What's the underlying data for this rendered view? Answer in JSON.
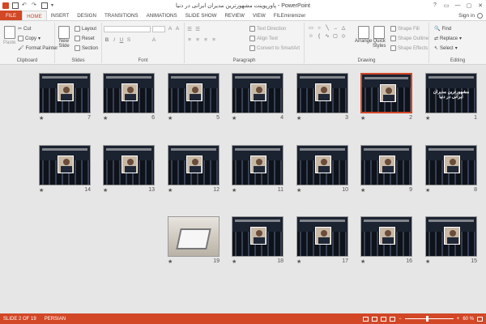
{
  "window": {
    "title": "پاورپوینت مشهورترین مدیران ایرانی در دنیا - PowerPoint",
    "controls": [
      "?",
      "▭",
      "—",
      "▢",
      "✕"
    ]
  },
  "tabs": [
    "FILE",
    "HOME",
    "INSERT",
    "DESIGN",
    "TRANSITIONS",
    "ANIMATIONS",
    "SLIDE SHOW",
    "REVIEW",
    "VIEW",
    "FILEminimizer"
  ],
  "active_tab": "HOME",
  "account": {
    "sign_in": "Sign in"
  },
  "ribbon": {
    "clipboard": {
      "label": "Clipboard",
      "paste": "Paste",
      "cut": "Cut",
      "copy": "Copy",
      "format_painter": "Format Painter"
    },
    "slides": {
      "label": "Slides",
      "new_slide": "New",
      "new_slide_2": "Slide",
      "layout": "Layout",
      "reset": "Reset",
      "section": "Section"
    },
    "font": {
      "label": "Font"
    },
    "paragraph": {
      "label": "Paragraph",
      "text_direction": "Text Direction",
      "align_text": "Align Text",
      "convert_smartart": "Convert to SmartArt"
    },
    "drawing": {
      "label": "Drawing",
      "arrange": "Arrange",
      "quick_styles": "Quick",
      "quick_styles_2": "Styles",
      "shape_fill": "Shape Fill",
      "shape_outline": "Shape Outline",
      "shape_effects": "Shape Effects"
    },
    "editing": {
      "label": "Editing",
      "find": "Find",
      "replace": "Replace",
      "select": "Select"
    }
  },
  "slides": [
    {
      "number": "1",
      "kind": "title",
      "text": "مشهورترین مدیران ایرانی در دنیا"
    },
    {
      "number": "2",
      "kind": "photo",
      "selected": true
    },
    {
      "number": "3",
      "kind": "photo"
    },
    {
      "number": "4",
      "kind": "photo"
    },
    {
      "number": "5",
      "kind": "photo"
    },
    {
      "number": "6",
      "kind": "photo"
    },
    {
      "number": "7",
      "kind": "photo"
    },
    {
      "number": "8",
      "kind": "photo"
    },
    {
      "number": "9",
      "kind": "photo"
    },
    {
      "number": "10",
      "kind": "photo"
    },
    {
      "number": "11",
      "kind": "photo"
    },
    {
      "number": "12",
      "kind": "photo"
    },
    {
      "number": "13",
      "kind": "photo"
    },
    {
      "number": "14",
      "kind": "photo"
    },
    {
      "number": "15",
      "kind": "photo"
    },
    {
      "number": "16",
      "kind": "photo"
    },
    {
      "number": "17",
      "kind": "photo"
    },
    {
      "number": "18",
      "kind": "photo"
    },
    {
      "number": "19",
      "kind": "laptop"
    }
  ],
  "status": {
    "slide_info": "SLIDE 2 OF 19",
    "language": "PERSIAN",
    "zoom": "60 %",
    "minus": "−",
    "plus": "+"
  },
  "colors": {
    "accent": "#d24726",
    "ribbon_bg": "#f3f3f3",
    "canvas_bg": "#e6e6e6"
  }
}
